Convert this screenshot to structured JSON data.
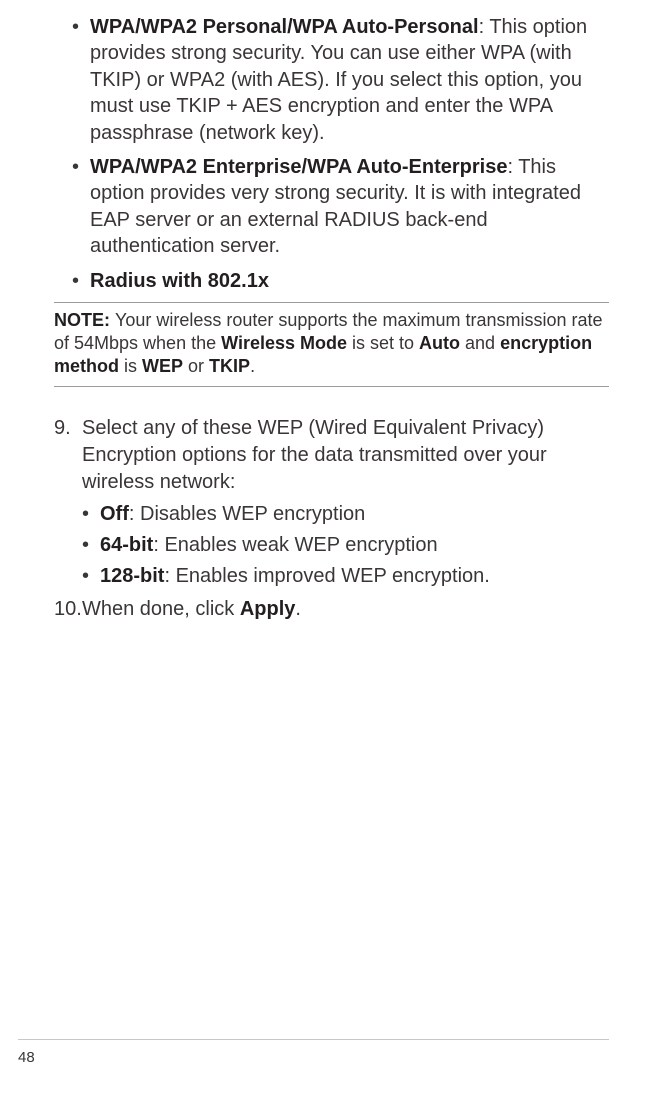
{
  "options": {
    "wpa_personal": {
      "title": "WPA/WPA2 Personal/WPA Auto-Personal",
      "desc": ": This option provides strong security. You can use either WPA (with TKIP) or WPA2 (with AES). If you select this option, you must use TKIP + AES encryption and enter the WPA passphrase (network key)."
    },
    "wpa_enterprise": {
      "title": "WPA/WPA2 Enterprise/WPA Auto-Enterprise",
      "desc": ": This option provides very strong security. It is with integrated EAP server or an external RADIUS back-end authentication server."
    },
    "radius": {
      "title": "Radius with 802.1x"
    }
  },
  "note": {
    "label": "NOTE:  ",
    "part1": "Your wireless router supports the maximum transmission rate of 54Mbps when the ",
    "b1": "Wireless Mode",
    "part2": " is set to ",
    "b2": "Auto",
    "part3": " and ",
    "b3": "encryption method",
    "part4": " is ",
    "b4": "WEP",
    "part5": " or ",
    "b5": "TKIP",
    "part6": "."
  },
  "step9": {
    "num": "9.",
    "text": "Select any of these WEP (Wired Equivalent Privacy) Encryption options for the data transmitted over your wireless network:",
    "bullets": {
      "off": {
        "b": "Off",
        "t": ": Disables WEP encryption"
      },
      "b64": {
        "b": "64-bit",
        "t": ": Enables weak WEP encryption"
      },
      "b128": {
        "b": "128-bit",
        "t": ": Enables improved WEP encryption."
      }
    }
  },
  "step10": {
    "num": "10.",
    "t1": "When done, click ",
    "b": "Apply",
    "t2": "."
  },
  "page_number": "48"
}
